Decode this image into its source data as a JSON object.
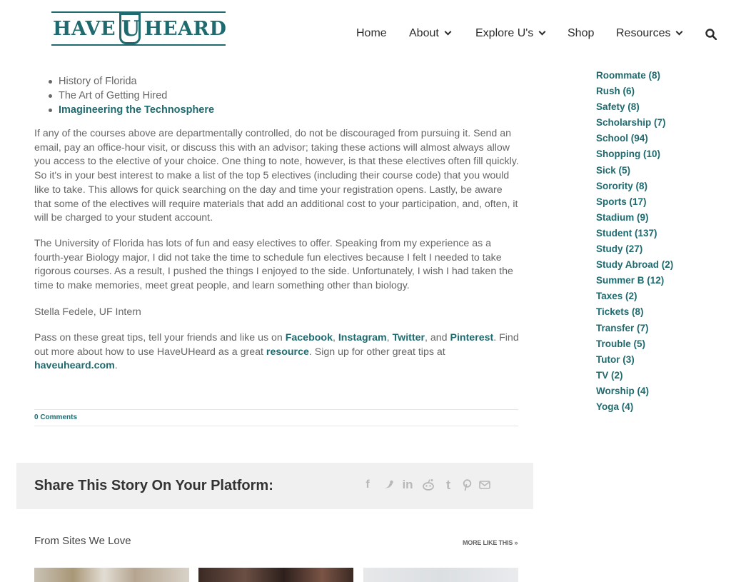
{
  "header": {
    "logo": {
      "word1": "HAVE",
      "letter": "U",
      "word2": "HEARD"
    },
    "nav": [
      {
        "label": "Home",
        "has_dropdown": false
      },
      {
        "label": "About",
        "has_dropdown": true
      },
      {
        "label": "Explore U's",
        "has_dropdown": true
      },
      {
        "label": "Shop",
        "has_dropdown": false
      },
      {
        "label": "Resources",
        "has_dropdown": true
      }
    ],
    "search_icon": "search-icon"
  },
  "article": {
    "bullets": [
      {
        "text": "History of Florida",
        "is_link": false
      },
      {
        "text": "The Art of Getting Hired",
        "is_link": false
      },
      {
        "text": "Imagineering the Technosphere",
        "is_link": true
      }
    ],
    "p1": "If any of the courses above are departmentally controlled, do not be discouraged from pursuing it. Send an email, pay an office-hour visit, or discuss this with an advisor; taking these actions will almost always allow you access to the elective of your choice. One thing to note, however, is that these electives often fill quickly. So it's in your best interest to make a list of the top 5 electives (including their course code) that you would like to take. This allows for quick searching on the day and time your registration opens. Lastly, be aware that some of the electives will require materials that add an additional cost to your participation, and, often, it will be charged to your student account.",
    "p2": "The University of Florida has lots of fun and easy electives to offer. Speaking from my experience as a fourth-year Biology major, I did not take the time to schedule fun electives because I felt I needed to take rigorous courses. As a result, I pushed the things I enjoyed to the side. Unfortunately, I wish I had taken the time to make memories, meet great people, and learn something other than biology.",
    "author": "Stella Fedele, UF Intern",
    "p4": {
      "pre": "Pass on these great tips, tell your friends and like us on ",
      "facebook": "Facebook",
      "comma1": ", ",
      "instagram": "Instagram",
      "comma2": ", ",
      "twitter": "Twitter",
      "and": ", and ",
      "pinterest": "Pinterest",
      "mid": ". Find out more about how to use HaveUHeard as a great ",
      "resource": "resource",
      "mid2": ". Sign up for other great tips at ",
      "site": "haveuheard.com",
      "end": "."
    },
    "comments": "0 Comments"
  },
  "share": {
    "title": "Share This Story On Your Platform:",
    "icons": [
      "facebook-icon",
      "twitter-icon",
      "linkedin-icon",
      "reddit-icon",
      "tumblr-icon",
      "pinterest-icon",
      "email-icon"
    ]
  },
  "related": {
    "heading": "From Sites We Love",
    "more": "MORE LIKE THIS »"
  },
  "sidebar": {
    "categories": [
      "Roommate (8)",
      "Rush (6)",
      "Safety (8)",
      "Scholarship (7)",
      "School (94)",
      "Shopping (10)",
      "Sick (5)",
      "Sorority (8)",
      "Sports (17)",
      "Stadium (9)",
      "Student (137)",
      "Study (27)",
      "Study Abroad (2)",
      "Summer B (12)",
      "Taxes (2)",
      "Tickets (8)",
      "Transfer (7)",
      "Trouble (5)",
      "Tutor (3)",
      "TV (2)",
      "Worship (4)",
      "Yoga (4)"
    ]
  },
  "colors": {
    "brand": "#1e6a6e",
    "text": "#666666",
    "share_bg": "#f0f0f0"
  }
}
